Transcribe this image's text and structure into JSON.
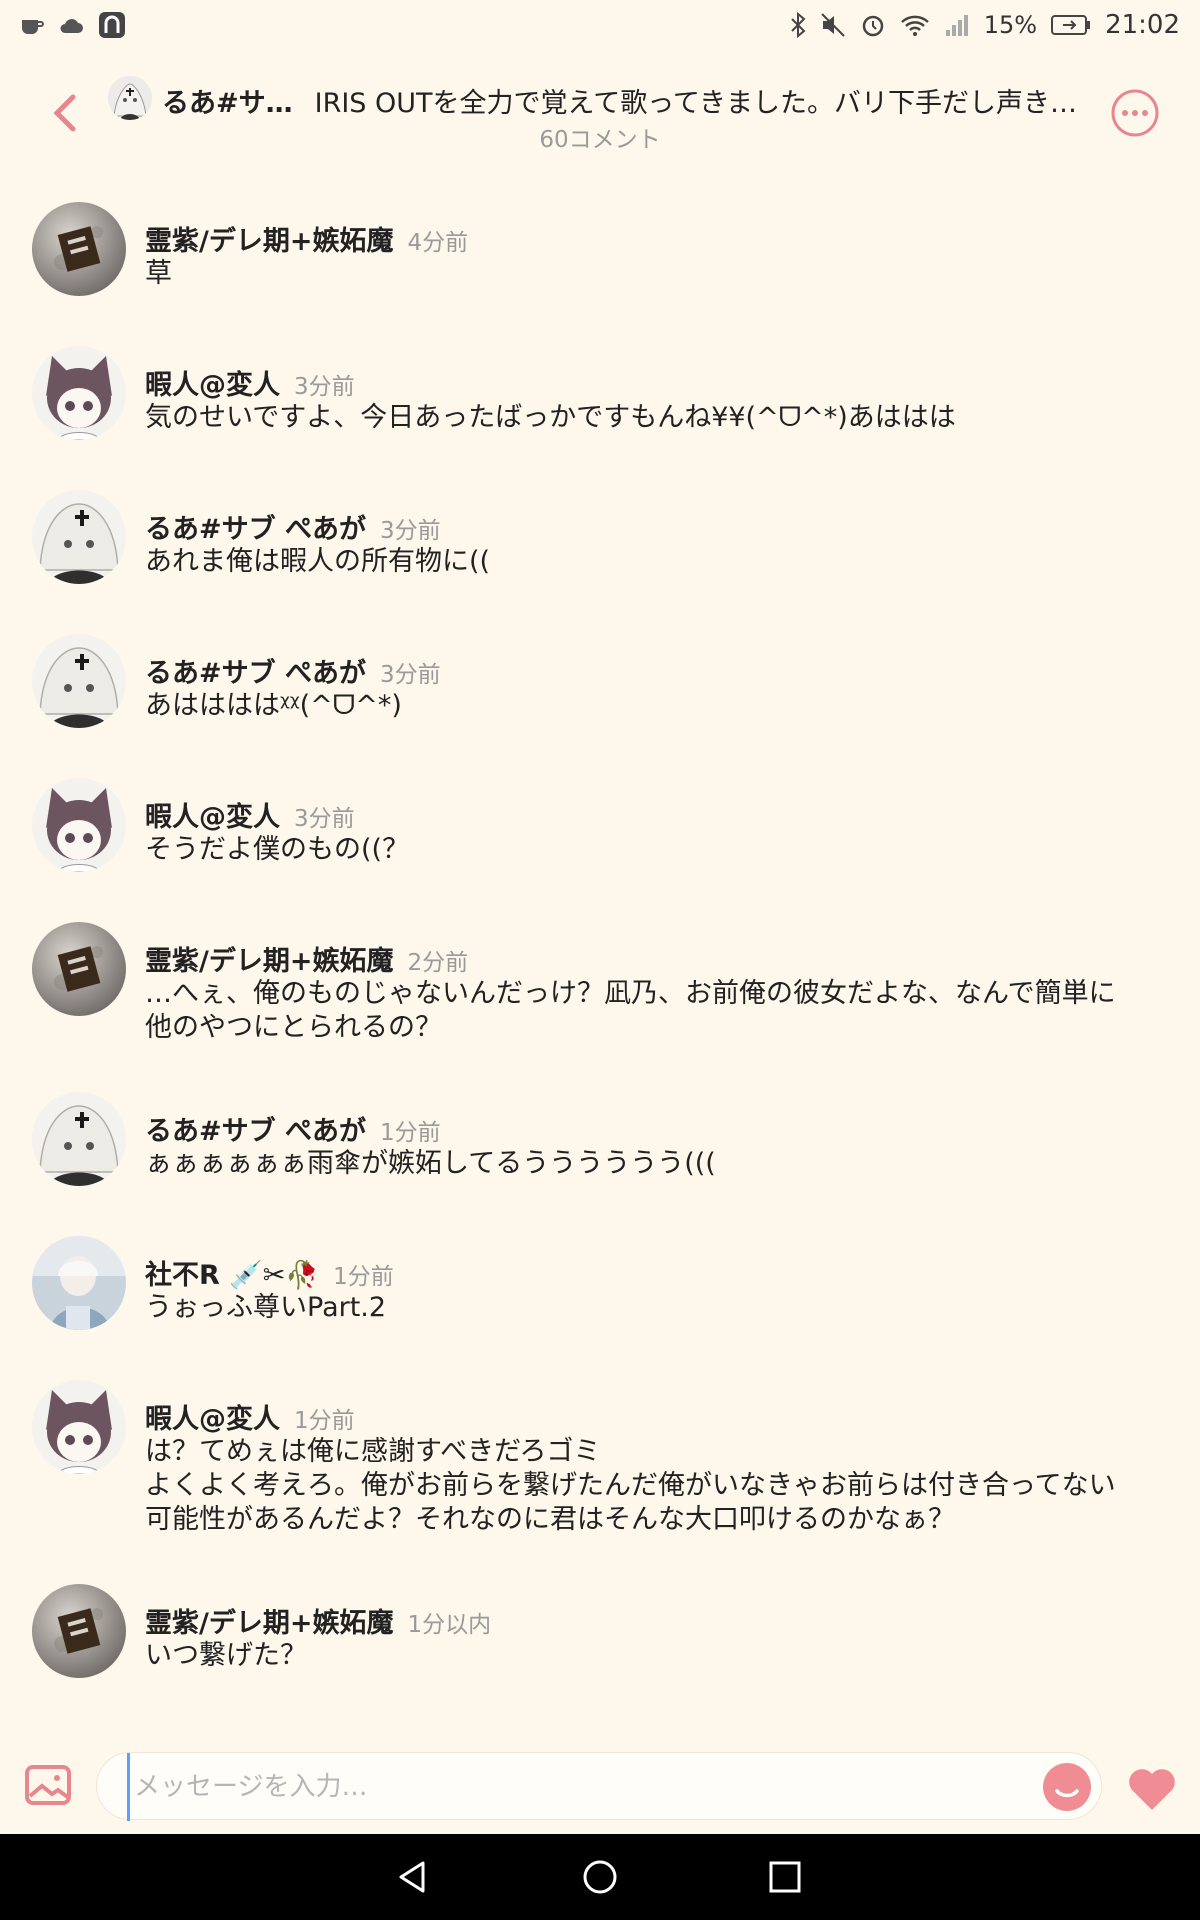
{
  "status_bar": {
    "battery_percent": "15%",
    "time": "21:02"
  },
  "header": {
    "user": "るあ#サ…",
    "title": "IRIS OUTを全力で覚えて歌ってきました。バリ下手だし声き…",
    "comment_count": "60コメント"
  },
  "comments": [
    {
      "name": "霊紫/デレ期+嫉妬魔",
      "time": "4分前",
      "text": "草",
      "avatar": "moon-avatar"
    },
    {
      "name": "暇人@変人",
      "time": "3分前",
      "text": "気のせいですよ、今日あったばっかですもんね¥¥(^ᗜ^*)あははは",
      "avatar": "catboy-avatar"
    },
    {
      "name": "るあ#サブ ぺあが",
      "time": "3分前",
      "text": "あれま俺は暇人の所有物に((",
      "avatar": "white-hair-avatar"
    },
    {
      "name": "るあ#サブ ぺあが",
      "time": "3分前",
      "text": "あははははᵡᵡ(^ᗜ^*)",
      "avatar": "white-hair-avatar"
    },
    {
      "name": "暇人@変人",
      "time": "3分前",
      "text": "そうだよ僕のもの((？",
      "avatar": "catboy-avatar"
    },
    {
      "name": "霊紫/デレ期+嫉妬魔",
      "time": "2分前",
      "text": "…へぇ、俺のものじゃないんだっけ？凪乃、お前俺の彼女だよな、なんで簡単に\n他のやつにとられるの？",
      "avatar": "moon-avatar"
    },
    {
      "name": "るあ#サブ ぺあが",
      "time": "1分前",
      "text": "ぁぁぁぁぁぁ雨傘が嫉妬してるうううううう(((",
      "avatar": "white-hair-avatar"
    },
    {
      "name": "社不R 💉✂🥀",
      "time": "1分前",
      "text": "うぉっふ尊いPart.2",
      "avatar": "photo-avatar"
    },
    {
      "name": "暇人@変人",
      "time": "1分前",
      "text": "は？てめぇは俺に感謝すべきだろゴミ\nよくよく考えろ。俺がお前らを繋げたんだ俺がいなきゃお前らは付き合ってない\n可能性があるんだよ？それなのに君はそんな大口叩けるのかなぁ？",
      "avatar": "catboy-avatar"
    },
    {
      "name": "霊紫/デレ期+嫉妬魔",
      "time": "1分以内",
      "text": "いつ繋げた？",
      "avatar": "moon-avatar"
    }
  ],
  "composer": {
    "placeholder": "メッセージを入力…"
  },
  "colors": {
    "accent": "#e8868e",
    "background": "#fdf7ec"
  }
}
